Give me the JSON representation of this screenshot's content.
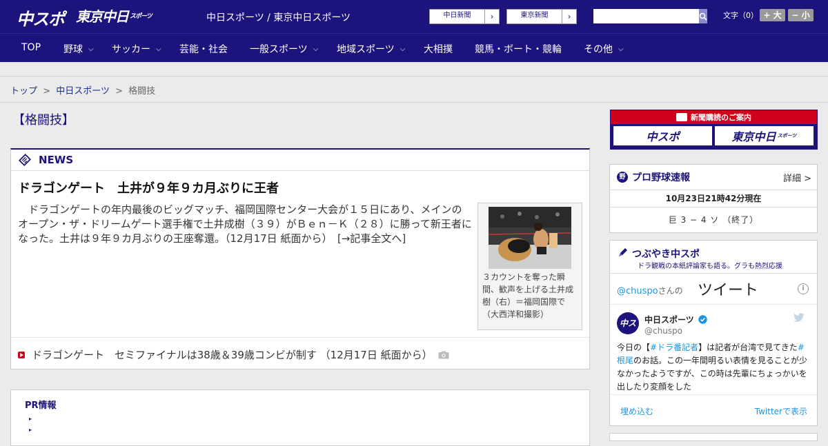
{
  "header": {
    "logo_chuspo": "中スポ",
    "logo_tokyo": "東京中日",
    "logo_tokyo_small": "スポーツ",
    "tagline": "中日スポーツ / 東京中日スポーツ",
    "ext_links": [
      "中日新聞",
      "東京新聞"
    ],
    "search_placeholder": "",
    "font_size_label": "文字（0）",
    "font_bigger": "+ 大",
    "font_smaller": "− 小",
    "brand_color": "#1c137d"
  },
  "nav": {
    "items": [
      {
        "label": "TOP"
      },
      {
        "label": "野球"
      },
      {
        "label": "サッカー"
      },
      {
        "label": "芸能・社会"
      },
      {
        "label": "一般スポーツ"
      },
      {
        "label": "地域スポーツ"
      },
      {
        "label": "大相撲"
      },
      {
        "label": "競馬・ボート・競輪"
      },
      {
        "label": "その他"
      }
    ]
  },
  "breadcrumb": {
    "items": [
      "トップ",
      "中日スポーツ"
    ],
    "current": "格闘技",
    "separator": ">"
  },
  "section_title": "【格闘技】",
  "news": {
    "label": "NEWS",
    "headline": "ドラゴンゲート　土井が９年９カ月ぶりに王者",
    "lead": "　ドラゴンゲートの年内最後のビッグマッチ、福岡国際センター大会が１５日にあり、メインのオープン・ザ・ドリームゲート選手権で土井成樹（３９）がＢｅｎ－Ｋ（２８）に勝って新王者になった。土井は９年９カ月ぶりの王座奪還。（12月17日 紙面から）　",
    "more_link": "[→記事全文へ]",
    "photo_caption": "３カウントを奪った瞬間、歓声を上げる土井成樹（右）＝福岡国際で（大西洋和撮影）",
    "related": "ドラゴンゲート　セミファイナルは38歳＆39歳コンビが制す （12月17日 紙面から）",
    "related_accent": "#d0021b"
  },
  "pr": {
    "title": "PR情報",
    "bullets": [
      "▸",
      "▸"
    ]
  },
  "sidebar": {
    "subscribe": {
      "bar": "新聞購読のご案内",
      "btn1": "中スポ",
      "btn2": "東京中日",
      "btn2_small": "スポーツ",
      "accent": "#d0021b"
    },
    "baseball": {
      "icon": "野",
      "title": "プロ野球速報",
      "more": "詳細 >",
      "time": "10月23日21時42分現在",
      "score": "巨 3 − 4 ソ （終了）"
    },
    "tweets": {
      "title": "つぶやき中スポ",
      "subtitle": "ドラ観戦の本紙評論家も語る。グラも熱烈応援",
      "handle": "@chuspo",
      "handle_suffix": "さんの",
      "heading": "ツイート",
      "info": "i",
      "author_name": "中日スポーツ",
      "author_handle": "@chuspo",
      "avatar_text": "中スポ",
      "body_1": "今日の【",
      "tag_1": "#ドラ番記者",
      "body_2": "】は記者が台湾で見てきた",
      "tag_2": "#根尾",
      "body_3": "のお話。この一年間明るい表情を見ることが少なかったようですが、この時は先輩にちょっかいを出したり変顔をした",
      "embed": "埋め込む",
      "view": "Twitterで表示",
      "link_color": "#1b95e0"
    }
  }
}
